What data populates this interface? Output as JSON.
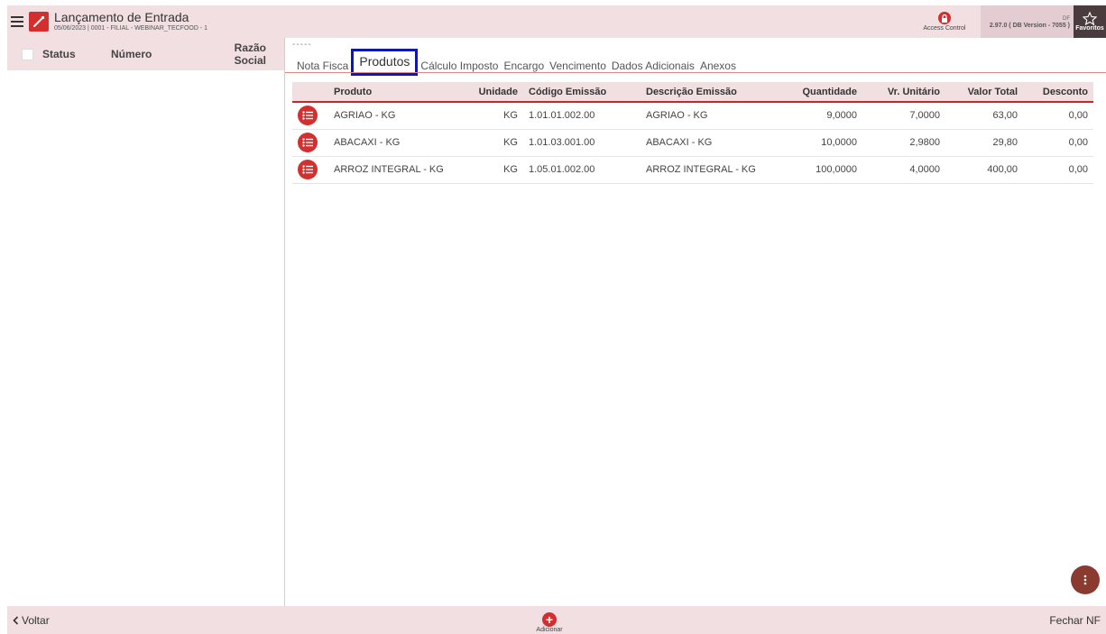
{
  "header": {
    "title": "Lançamento de Entrada",
    "subtitle": "05/06/2023 | 0001 - FILIAL - WEBINAR_TECFOOD - 1",
    "access_control": "Access Control",
    "version_top": "DF",
    "version": "2.97.0 ( DB Version - 7055 )",
    "favorites": "Favoritos"
  },
  "left_panel": {
    "columns": [
      "Status",
      "Número",
      "Razão Social"
    ]
  },
  "tabs_dots": "-----",
  "tabs": [
    {
      "label": "Nota Fisca",
      "active": false
    },
    {
      "label": "Produtos",
      "active": true
    },
    {
      "label": "Cálculo Imposto",
      "active": false
    },
    {
      "label": "Encargo",
      "active": false
    },
    {
      "label": "Vencimento",
      "active": false
    },
    {
      "label": "Dados Adicionais",
      "active": false
    },
    {
      "label": "Anexos",
      "active": false
    }
  ],
  "table": {
    "headers": [
      "Produto",
      "Unidade",
      "Código Emissão",
      "Descrição Emissão",
      "Quantidade",
      "Vr. Unitário",
      "Valor Total",
      "Desconto"
    ],
    "rows": [
      [
        "AGRIAO - KG",
        "KG",
        "1.01.01.002.00",
        "AGRIAO - KG",
        "9,0000",
        "7,0000",
        "63,00",
        "0,00"
      ],
      [
        "ABACAXI - KG",
        "KG",
        "1.01.03.001.00",
        "ABACAXI - KG",
        "10,0000",
        "2,9800",
        "29,80",
        "0,00"
      ],
      [
        "ARROZ INTEGRAL - KG",
        "KG",
        "1.05.01.002.00",
        "ARROZ INTEGRAL - KG",
        "100,0000",
        "4,0000",
        "400,00",
        "0,00"
      ]
    ]
  },
  "footer": {
    "back": "Voltar",
    "add": "Adicionar",
    "close": "Fechar NF"
  },
  "colors": {
    "accent": "#d32f2f",
    "header_bg": "#f1dfe2",
    "highlight_border": "#0d17b5"
  }
}
